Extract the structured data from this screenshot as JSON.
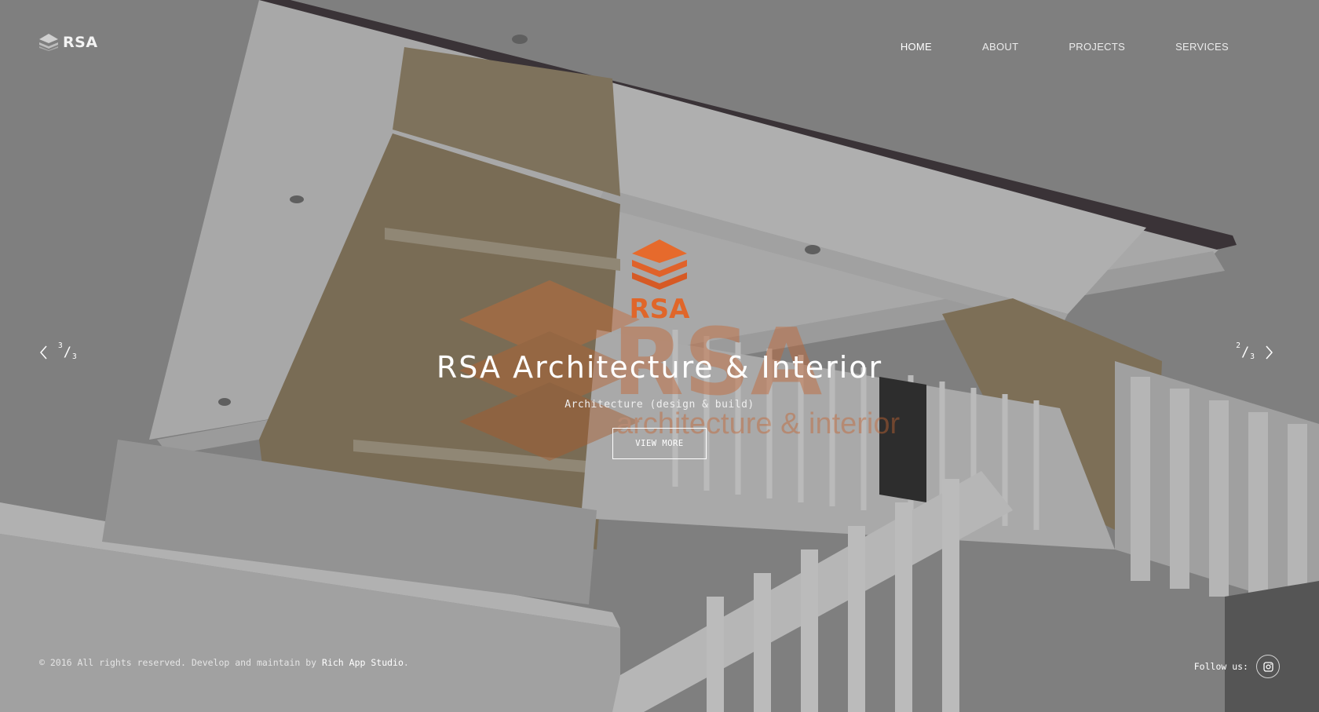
{
  "brand": {
    "logo_text": "RSA",
    "accent_color": "#e0662a"
  },
  "nav": {
    "items": [
      {
        "label": "HOME",
        "active": true
      },
      {
        "label": "ABOUT",
        "active": false
      },
      {
        "label": "PROJECTS",
        "active": false
      },
      {
        "label": "SERVICES",
        "active": false
      }
    ]
  },
  "hero": {
    "icon_caption": "RSA",
    "watermark_text": "RSA",
    "watermark_tagline": "architecture & interior",
    "title": "RSA Architecture & Interior",
    "subtitle": "Architecture (design & build)",
    "cta_label": "VIEW MORE"
  },
  "slider": {
    "prev": {
      "current": "3",
      "total": "3",
      "icon": "chevron-left-icon"
    },
    "next": {
      "current": "2",
      "total": "3",
      "icon": "chevron-right-icon"
    }
  },
  "footer": {
    "copyright_prefix": "© 2016 All rights reserved. Develop and maintain by",
    "studio_link": "Rich App Studio",
    "copyright_suffix": ".",
    "follow_label": "Follow us:",
    "social_icon": "instagram-icon"
  }
}
